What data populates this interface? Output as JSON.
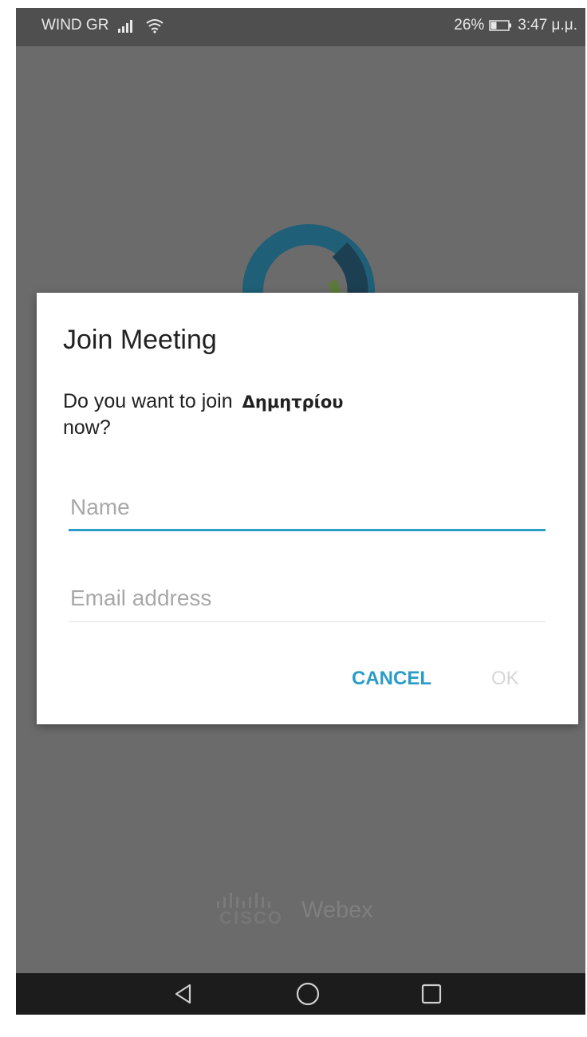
{
  "status_bar": {
    "carrier": "WIND GR",
    "battery_percent": "26%",
    "time": "3:47 μ.μ.",
    "icons": [
      "signal-icon",
      "wifi-icon",
      "battery-icon"
    ]
  },
  "dialog": {
    "title": "Join Meeting",
    "message_prefix": "Do you want to join",
    "meeting_name": "Δημητρίου",
    "message_suffix": "now?",
    "name_field": {
      "placeholder": "Name",
      "value": ""
    },
    "email_field": {
      "placeholder": "Email address",
      "value": ""
    },
    "cancel_label": "CANCEL",
    "ok_label": "OK"
  },
  "brand": {
    "company": "CISCO",
    "product": "Webex"
  },
  "nav_bar": {
    "icons": [
      "back-icon",
      "home-icon",
      "recents-icon"
    ]
  },
  "colors": {
    "accent": "#2a9cc7",
    "dim_overlay": "#6b6b6b",
    "ok_disabled": "#d6d6d6"
  }
}
